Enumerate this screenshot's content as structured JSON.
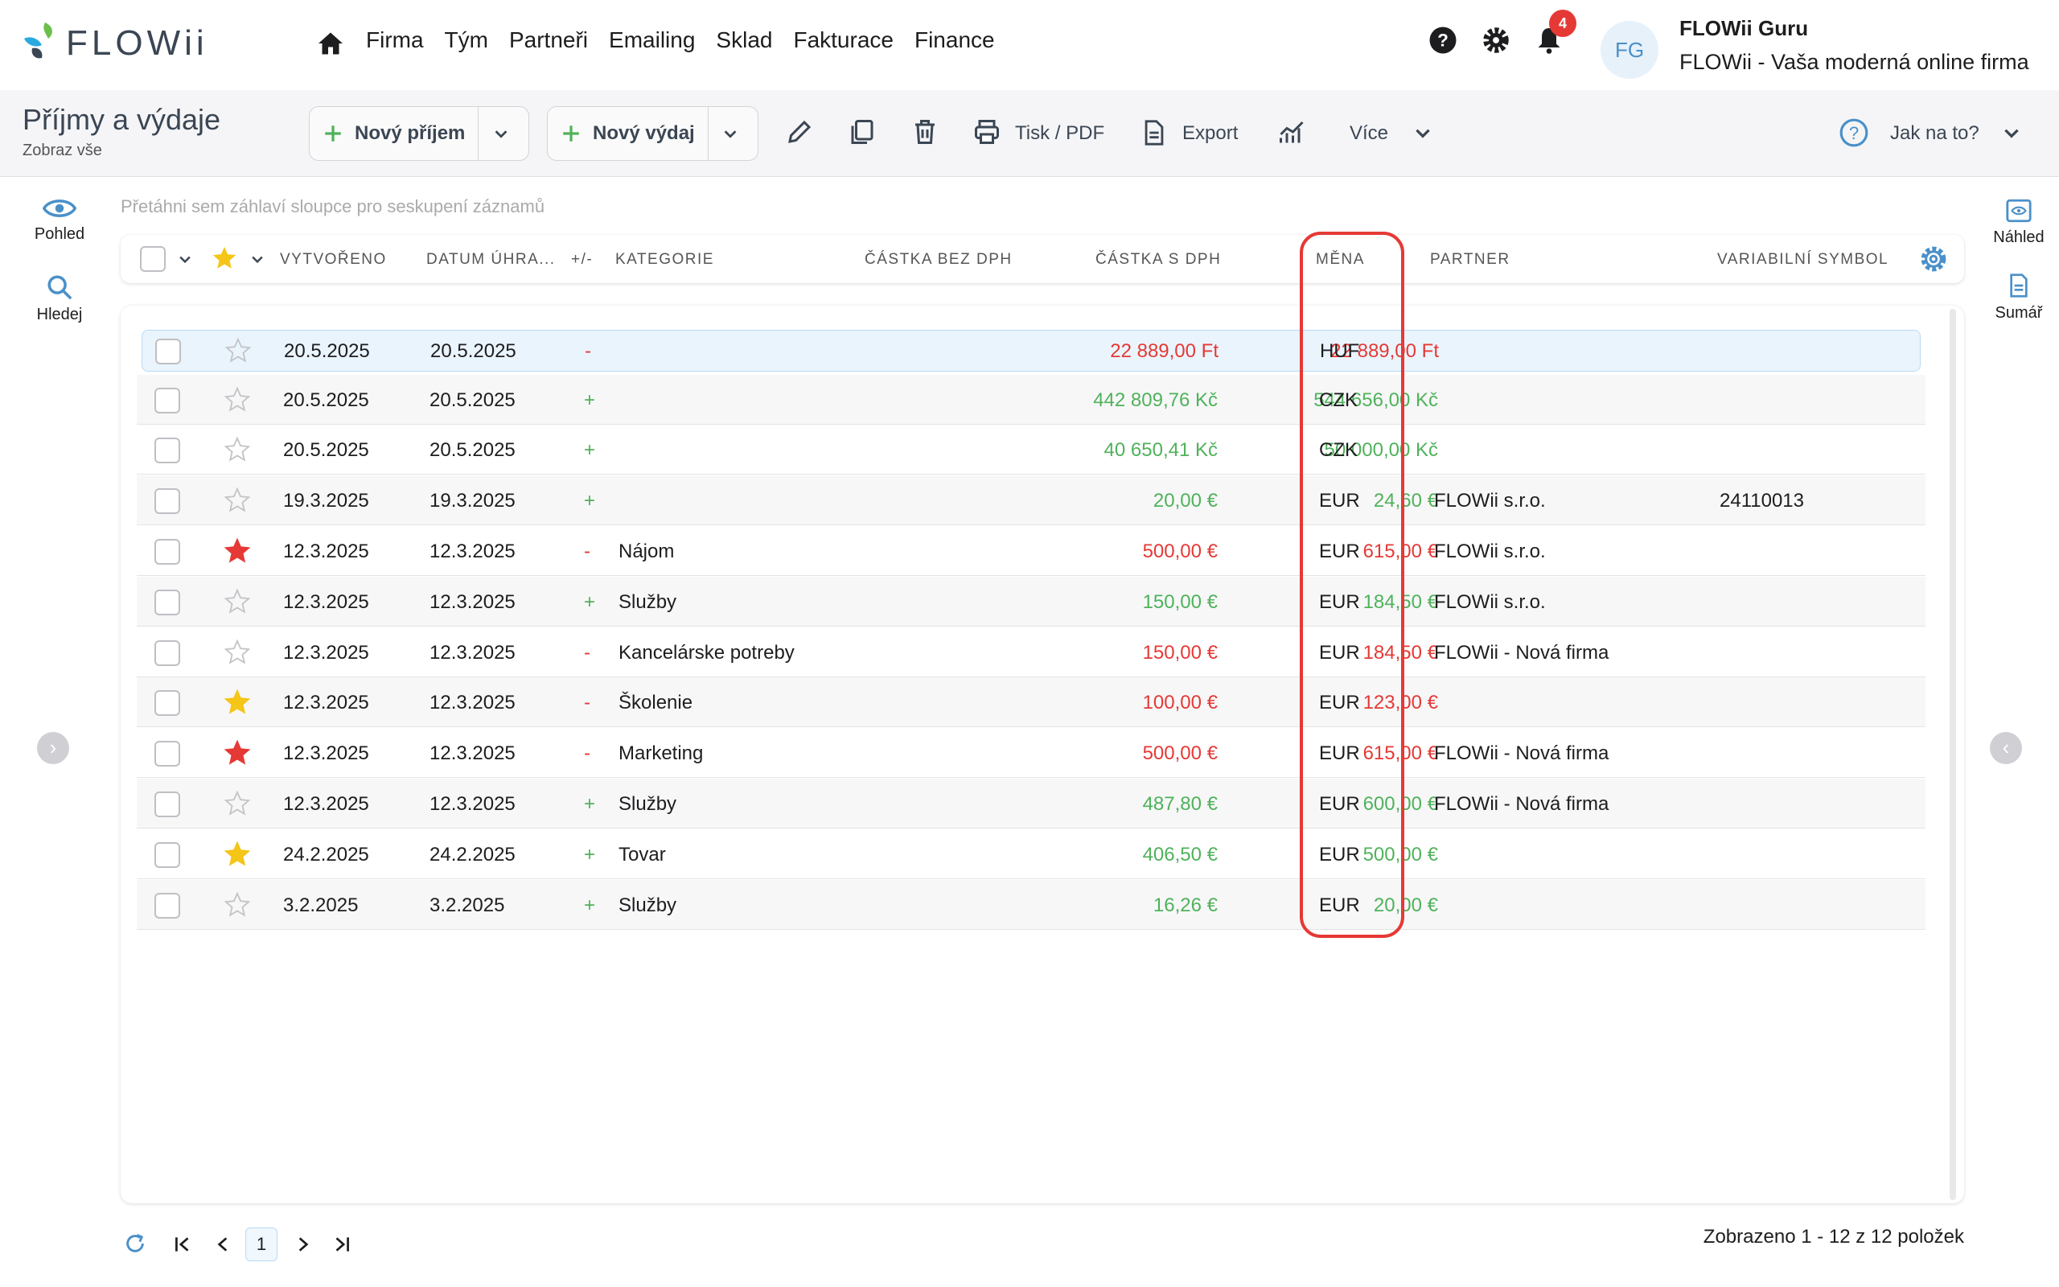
{
  "brand": {
    "name": "FLOWii"
  },
  "nav": {
    "items": [
      "Firma",
      "Tým",
      "Partneři",
      "Emailing",
      "Sklad",
      "Fakturace",
      "Finance"
    ]
  },
  "notifications": {
    "count": "4"
  },
  "user": {
    "initials": "FG",
    "name": "FLOWii Guru",
    "firm": "FLOWii - Vaša moderná online firma"
  },
  "page": {
    "title": "Příjmy a výdaje",
    "subtitle": "Zobraz vše"
  },
  "toolbar": {
    "new_income": "Nový příjem",
    "new_expense": "Nový výdaj",
    "print": "Tisk / PDF",
    "export": "Export",
    "more": "Více",
    "help": "Jak na to?"
  },
  "left_sidebar": {
    "view": "Pohled",
    "search": "Hledej"
  },
  "right_sidebar": {
    "preview": "Náhled",
    "summary": "Sumář"
  },
  "grid": {
    "group_hint": "Přetáhni sem záhlaví sloupce pro seskupení záznamů",
    "columns": {
      "created": "VYTVOŘENO",
      "paid": "DATUM ÚHRA...",
      "sign": "+/-",
      "category": "KATEGORIE",
      "net": "ČÁSTKA BEZ DPH",
      "gross": "ČÁSTKA S DPH",
      "currency": "MĚNA",
      "partner": "PARTNER",
      "vs": "VARIABILNÍ SYMBOL"
    },
    "rows": [
      {
        "star": "empty",
        "created": "20.5.2025",
        "paid": "20.5.2025",
        "sign": "-",
        "category": "",
        "net": "22 889,00 Ft",
        "gross": "22 889,00 Ft",
        "currency": "HUF",
        "partner": "",
        "vs": ""
      },
      {
        "star": "empty",
        "created": "20.5.2025",
        "paid": "20.5.2025",
        "sign": "+",
        "category": "",
        "net": "442 809,76 Kč",
        "gross": "544 656,00 Kč",
        "currency": "CZK",
        "partner": "",
        "vs": ""
      },
      {
        "star": "empty",
        "created": "20.5.2025",
        "paid": "20.5.2025",
        "sign": "+",
        "category": "",
        "net": "40 650,41 Kč",
        "gross": "50 000,00 Kč",
        "currency": "CZK",
        "partner": "",
        "vs": ""
      },
      {
        "star": "empty",
        "created": "19.3.2025",
        "paid": "19.3.2025",
        "sign": "+",
        "category": "",
        "net": "20,00 €",
        "gross": "24,60 €",
        "currency": "EUR",
        "partner": "FLOWii s.r.o.",
        "vs": "24110013"
      },
      {
        "star": "red",
        "created": "12.3.2025",
        "paid": "12.3.2025",
        "sign": "-",
        "category": "Nájom",
        "net": "500,00 €",
        "gross": "615,00 €",
        "currency": "EUR",
        "partner": "FLOWii s.r.o.",
        "vs": ""
      },
      {
        "star": "empty",
        "created": "12.3.2025",
        "paid": "12.3.2025",
        "sign": "+",
        "category": "Služby",
        "net": "150,00 €",
        "gross": "184,50 €",
        "currency": "EUR",
        "partner": "FLOWii s.r.o.",
        "vs": ""
      },
      {
        "star": "empty",
        "created": "12.3.2025",
        "paid": "12.3.2025",
        "sign": "-",
        "category": "Kancelárske potreby",
        "net": "150,00 €",
        "gross": "184,50 €",
        "currency": "EUR",
        "partner": "FLOWii - Nová firma",
        "vs": ""
      },
      {
        "star": "gold",
        "created": "12.3.2025",
        "paid": "12.3.2025",
        "sign": "-",
        "category": "Školenie",
        "net": "100,00 €",
        "gross": "123,00 €",
        "currency": "EUR",
        "partner": "",
        "vs": ""
      },
      {
        "star": "red",
        "created": "12.3.2025",
        "paid": "12.3.2025",
        "sign": "-",
        "category": "Marketing",
        "net": "500,00 €",
        "gross": "615,00 €",
        "currency": "EUR",
        "partner": "FLOWii - Nová firma",
        "vs": ""
      },
      {
        "star": "empty",
        "created": "12.3.2025",
        "paid": "12.3.2025",
        "sign": "+",
        "category": "Služby",
        "net": "487,80 €",
        "gross": "600,00 €",
        "currency": "EUR",
        "partner": "FLOWii - Nová firma",
        "vs": ""
      },
      {
        "star": "gold",
        "created": "24.2.2025",
        "paid": "24.2.2025",
        "sign": "+",
        "category": "Tovar",
        "net": "406,50 €",
        "gross": "500,00 €",
        "currency": "EUR",
        "partner": "",
        "vs": ""
      },
      {
        "star": "empty",
        "created": "3.2.2025",
        "paid": "3.2.2025",
        "sign": "+",
        "category": "Služby",
        "net": "16,26 €",
        "gross": "20,00 €",
        "currency": "EUR",
        "partner": "",
        "vs": ""
      }
    ]
  },
  "pager": {
    "current_page": "1",
    "summary": "Zobrazeno 1 - 12 z 12 položek"
  },
  "colors": {
    "accent": "#4a90c9",
    "positive": "#4fb25a",
    "negative": "#e53935",
    "star_gold": "#f5c518",
    "highlight": "#e53935"
  }
}
